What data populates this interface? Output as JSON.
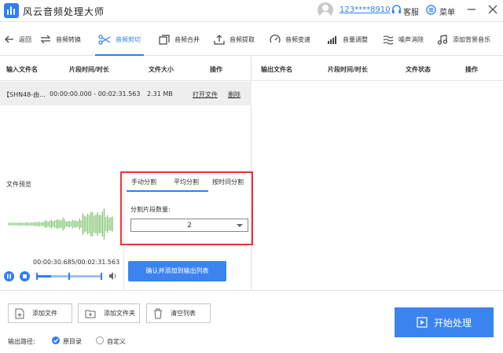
{
  "app": {
    "title": "风云音频处理大师"
  },
  "header": {
    "user_id": "123****8910",
    "support_label": "客服",
    "menu_label": "菜单"
  },
  "nav": {
    "back": "返回",
    "tabs": [
      {
        "label": "音频转换"
      },
      {
        "label": "音频剪切"
      },
      {
        "label": "音频合并"
      },
      {
        "label": "音频提取"
      },
      {
        "label": "音频变速"
      },
      {
        "label": "音量调整"
      },
      {
        "label": "噪声消除"
      },
      {
        "label": "添加背景音乐"
      }
    ],
    "active": "音频剪切"
  },
  "input_table": {
    "columns": [
      "输入文件名",
      "片段时间/时长",
      "文件大小",
      "操作"
    ],
    "rows": [
      {
        "name": "【SHN48-由...",
        "range": "00:00:00.000 - 00:02:31.563",
        "size": "2.31 MB",
        "open": "打开文件",
        "delete": "删除"
      }
    ]
  },
  "output_table": {
    "columns": [
      "输出文件名",
      "片段时间/时长",
      "文件状态",
      "操作"
    ]
  },
  "preview": {
    "label": "文件预览",
    "time": "00:00:30.685/00:02:31.563",
    "progress": 0.22
  },
  "split": {
    "tabs": [
      "手动分割",
      "平均分割",
      "按时间分割"
    ],
    "active": "平均分割",
    "count_label": "分割片段数量:",
    "count_value": "2",
    "confirm_label": "确认并添加到输出列表"
  },
  "bottom": {
    "add_file": "添加文件",
    "add_folder": "添加文件夹",
    "clear_list": "清空列表",
    "output_path_label": "输出路径:",
    "option_original": "原目录",
    "option_custom": "自定义",
    "selected": "原目录",
    "start_label": "开始处理"
  },
  "colors": {
    "accent": "#2f7ef5",
    "highlight_box": "#e33333",
    "waveform": "#7bc46a"
  }
}
